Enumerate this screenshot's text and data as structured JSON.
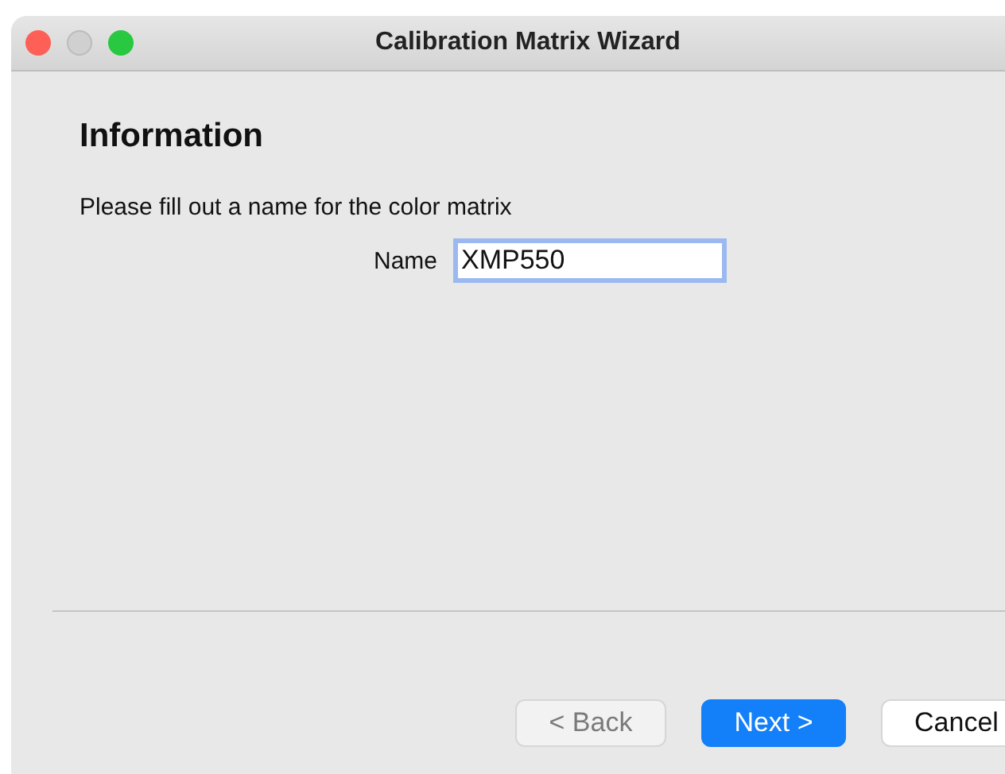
{
  "window": {
    "title": "Calibration Matrix Wizard",
    "minimize_disabled": true
  },
  "page": {
    "heading": "Information",
    "instruction": "Please fill out a name for the color matrix"
  },
  "name_field": {
    "label": "Name",
    "value": "XMP550",
    "focused": true
  },
  "buttons": [
    {
      "label": "< Back",
      "disabled": true,
      "default": false
    },
    {
      "label": "Next >",
      "disabled": false,
      "default": true
    },
    {
      "label": "Cancel",
      "disabled": false,
      "default": false
    }
  ]
}
